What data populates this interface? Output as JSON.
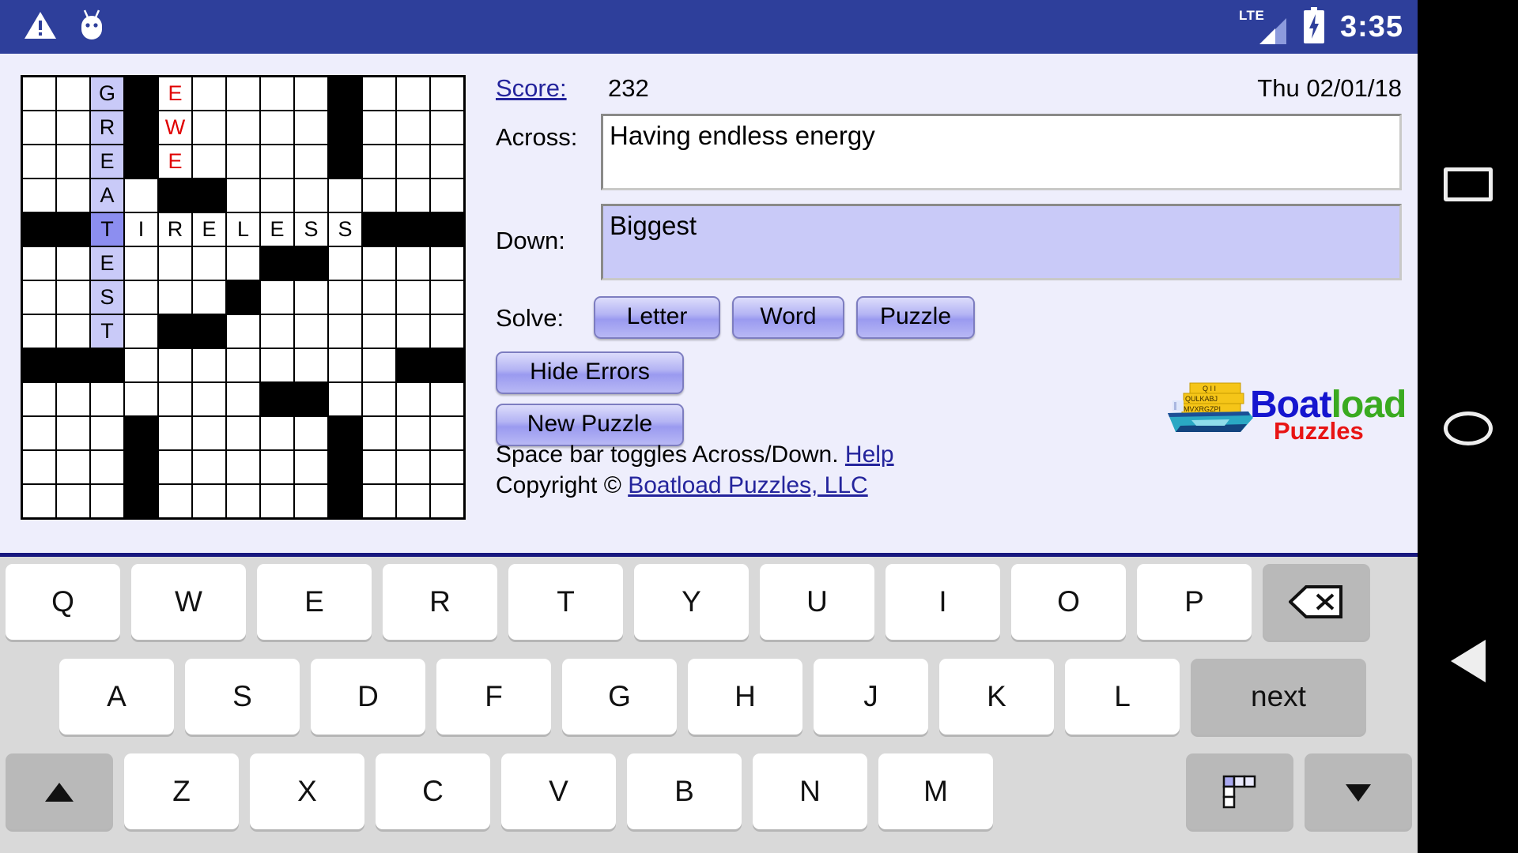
{
  "status_bar": {
    "time": "3:35",
    "network_label": "LTE",
    "icons": [
      "warning-icon",
      "android-icon",
      "lte-signal-icon",
      "battery-charging-icon"
    ]
  },
  "puzzle": {
    "score_label": "Score:",
    "score_value": "232",
    "date": "Thu 02/01/18",
    "across_label": "Across:",
    "across_clue": "Having endless energy",
    "down_label": "Down:",
    "down_clue": "Biggest",
    "solve_label": "Solve:",
    "solve_letter": "Letter",
    "solve_word": "Word",
    "solve_puzzle": "Puzzle",
    "hide_errors": "Hide Errors",
    "new_puzzle": "New Puzzle",
    "hint_text": "Space bar toggles Across/Down.",
    "help_link": "Help",
    "copyright_prefix": "Copyright ©",
    "copyright_link": "Boatload Puzzles, LLC"
  },
  "logo": {
    "word1": "Boat",
    "word2": "load",
    "word3": "Puzzles",
    "color1": "#1515cf",
    "color2": "#3aaa20",
    "color3": "#e81414",
    "tile_rows": [
      "Q I I",
      "Q U L K A B J",
      "M V X R G Z P I"
    ]
  },
  "grid": {
    "rows": 14,
    "cols": 13,
    "highlight_color": "#c9caf8",
    "cursor_color": "#8c8ef0",
    "error_color": "#e00000",
    "cells": [
      [
        {
          "t": "w"
        },
        {
          "t": "w"
        },
        {
          "t": "w",
          "l": "G",
          "s": "hl"
        },
        {
          "t": "b"
        },
        {
          "t": "w",
          "l": "E",
          "s": "err"
        },
        {
          "t": "w"
        },
        {
          "t": "w"
        },
        {
          "t": "w"
        },
        {
          "t": "w"
        },
        {
          "t": "b"
        },
        {
          "t": "w"
        },
        {
          "t": "w"
        },
        {
          "t": "w"
        }
      ],
      [
        {
          "t": "w"
        },
        {
          "t": "w"
        },
        {
          "t": "w",
          "l": "R",
          "s": "hl"
        },
        {
          "t": "b"
        },
        {
          "t": "w",
          "l": "W",
          "s": "err"
        },
        {
          "t": "w"
        },
        {
          "t": "w"
        },
        {
          "t": "w"
        },
        {
          "t": "w"
        },
        {
          "t": "b"
        },
        {
          "t": "w"
        },
        {
          "t": "w"
        },
        {
          "t": "w"
        }
      ],
      [
        {
          "t": "w"
        },
        {
          "t": "w"
        },
        {
          "t": "w",
          "l": "E",
          "s": "hl"
        },
        {
          "t": "b"
        },
        {
          "t": "w",
          "l": "E",
          "s": "err"
        },
        {
          "t": "w"
        },
        {
          "t": "w"
        },
        {
          "t": "w"
        },
        {
          "t": "w"
        },
        {
          "t": "b"
        },
        {
          "t": "w"
        },
        {
          "t": "w"
        },
        {
          "t": "w"
        }
      ],
      [
        {
          "t": "w"
        },
        {
          "t": "w"
        },
        {
          "t": "w",
          "l": "A",
          "s": "hl"
        },
        {
          "t": "w"
        },
        {
          "t": "b"
        },
        {
          "t": "b"
        },
        {
          "t": "w"
        },
        {
          "t": "w"
        },
        {
          "t": "w"
        },
        {
          "t": "w"
        },
        {
          "t": "w"
        },
        {
          "t": "w"
        },
        {
          "t": "w"
        }
      ],
      [
        {
          "t": "b"
        },
        {
          "t": "b"
        },
        {
          "t": "w",
          "l": "T",
          "s": "cur"
        },
        {
          "t": "w",
          "l": "I"
        },
        {
          "t": "w",
          "l": "R"
        },
        {
          "t": "w",
          "l": "E"
        },
        {
          "t": "w",
          "l": "L"
        },
        {
          "t": "w",
          "l": "E"
        },
        {
          "t": "w",
          "l": "S"
        },
        {
          "t": "w",
          "l": "S"
        },
        {
          "t": "b"
        },
        {
          "t": "b"
        },
        {
          "t": "b"
        }
      ],
      [
        {
          "t": "w"
        },
        {
          "t": "w"
        },
        {
          "t": "w",
          "l": "E",
          "s": "hl"
        },
        {
          "t": "w"
        },
        {
          "t": "w"
        },
        {
          "t": "w"
        },
        {
          "t": "w"
        },
        {
          "t": "b"
        },
        {
          "t": "b"
        },
        {
          "t": "w"
        },
        {
          "t": "w"
        },
        {
          "t": "w"
        },
        {
          "t": "w"
        }
      ],
      [
        {
          "t": "w"
        },
        {
          "t": "w"
        },
        {
          "t": "w",
          "l": "S",
          "s": "hl"
        },
        {
          "t": "w"
        },
        {
          "t": "w"
        },
        {
          "t": "w"
        },
        {
          "t": "b"
        },
        {
          "t": "w"
        },
        {
          "t": "w"
        },
        {
          "t": "w"
        },
        {
          "t": "w"
        },
        {
          "t": "w"
        },
        {
          "t": "w"
        }
      ],
      [
        {
          "t": "w"
        },
        {
          "t": "w"
        },
        {
          "t": "w",
          "l": "T",
          "s": "hl"
        },
        {
          "t": "w"
        },
        {
          "t": "b"
        },
        {
          "t": "b"
        },
        {
          "t": "w"
        },
        {
          "t": "w"
        },
        {
          "t": "w"
        },
        {
          "t": "w"
        },
        {
          "t": "w"
        },
        {
          "t": "w"
        },
        {
          "t": "w"
        }
      ],
      [
        {
          "t": "b"
        },
        {
          "t": "b"
        },
        {
          "t": "b"
        },
        {
          "t": "w"
        },
        {
          "t": "w"
        },
        {
          "t": "w"
        },
        {
          "t": "w"
        },
        {
          "t": "w"
        },
        {
          "t": "w"
        },
        {
          "t": "w"
        },
        {
          "t": "w"
        },
        {
          "t": "b"
        },
        {
          "t": "b"
        }
      ],
      [
        {
          "t": "w"
        },
        {
          "t": "w"
        },
        {
          "t": "w"
        },
        {
          "t": "w"
        },
        {
          "t": "w"
        },
        {
          "t": "w"
        },
        {
          "t": "w"
        },
        {
          "t": "b"
        },
        {
          "t": "b"
        },
        {
          "t": "w"
        },
        {
          "t": "w"
        },
        {
          "t": "w"
        },
        {
          "t": "w"
        }
      ],
      [
        {
          "t": "w"
        },
        {
          "t": "w"
        },
        {
          "t": "w"
        },
        {
          "t": "b"
        },
        {
          "t": "w"
        },
        {
          "t": "w"
        },
        {
          "t": "w"
        },
        {
          "t": "w"
        },
        {
          "t": "w"
        },
        {
          "t": "b"
        },
        {
          "t": "w"
        },
        {
          "t": "w"
        },
        {
          "t": "w"
        }
      ],
      [
        {
          "t": "w"
        },
        {
          "t": "w"
        },
        {
          "t": "w"
        },
        {
          "t": "b"
        },
        {
          "t": "w"
        },
        {
          "t": "w"
        },
        {
          "t": "w"
        },
        {
          "t": "w"
        },
        {
          "t": "w"
        },
        {
          "t": "b"
        },
        {
          "t": "w"
        },
        {
          "t": "w"
        },
        {
          "t": "w"
        }
      ],
      [
        {
          "t": "w"
        },
        {
          "t": "w"
        },
        {
          "t": "w"
        },
        {
          "t": "b"
        },
        {
          "t": "w"
        },
        {
          "t": "w"
        },
        {
          "t": "w"
        },
        {
          "t": "w"
        },
        {
          "t": "w"
        },
        {
          "t": "b"
        },
        {
          "t": "w"
        },
        {
          "t": "w"
        },
        {
          "t": "w"
        }
      ]
    ]
  },
  "keyboard": {
    "row1": [
      "Q",
      "W",
      "E",
      "R",
      "T",
      "Y",
      "U",
      "I",
      "O",
      "P"
    ],
    "row1_fn": "backspace-icon",
    "row2": [
      "A",
      "S",
      "D",
      "F",
      "G",
      "H",
      "J",
      "K",
      "L"
    ],
    "row2_fn": "next",
    "row3_shift": "shift-icon",
    "row3": [
      "Z",
      "X",
      "C",
      "V",
      "B",
      "N",
      "M"
    ],
    "row3_fn1": "grid-icon",
    "row3_fn2": "arrow-down-icon"
  },
  "navbar": {
    "recents": "recents-square-icon",
    "home": "home-circle-icon",
    "back": "back-triangle-icon"
  }
}
